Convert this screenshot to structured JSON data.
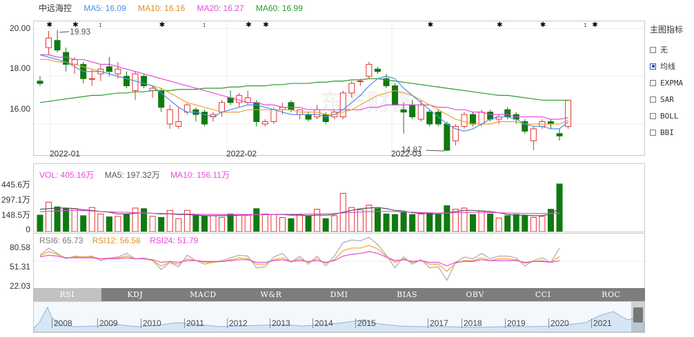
{
  "legend": {
    "name": "中远海控",
    "ma5": "MA5: 16.09",
    "ma10": "MA10: 16.16",
    "ma20": "MA20: 16.27",
    "ma60": "MA60: 16.99"
  },
  "colors": {
    "ma5": "#4a90e2",
    "ma10": "#f0a030",
    "ma20": "#e64ad8",
    "ma60": "#2a9a2a",
    "up": "#e53030",
    "down": "#0f7a0f"
  },
  "main_axis": [
    "20.00",
    "18.00",
    "16.00"
  ],
  "x_labels": [
    "2022-01",
    "2022-02",
    "2022-03"
  ],
  "annotations": {
    "high": "19.93",
    "low": "14.87"
  },
  "watermark": "东方财富",
  "side": {
    "title": "主图指标",
    "items": [
      {
        "label": "无",
        "checked": false
      },
      {
        "label": "均线",
        "checked": true
      },
      {
        "label": "EXPMA",
        "checked": false
      },
      {
        "label": "SAR",
        "checked": false
      },
      {
        "label": "BOLL",
        "checked": false
      },
      {
        "label": "BBI",
        "checked": false
      }
    ]
  },
  "vol": {
    "legend": {
      "vol": "VOL: 405.16万",
      "ma5": "MA5: 197.32万",
      "ma10": "MA10: 156.11万"
    },
    "axis": [
      "445.6万",
      "297.1万",
      "148.5万",
      "0"
    ]
  },
  "rsi": {
    "legend": {
      "rsi6": "RSI6: 65.73",
      "rsi12": "RSI12: 56.58",
      "rsi24": "RSI24: 51.79"
    },
    "axis": [
      "80.58",
      "51.31",
      "22.03"
    ]
  },
  "tabs": [
    {
      "label": "RSI",
      "active": true
    },
    {
      "label": "KDJ",
      "active": false
    },
    {
      "label": "MACD",
      "active": false
    },
    {
      "label": "W&R",
      "active": false
    },
    {
      "label": "DMI",
      "active": false
    },
    {
      "label": "BIAS",
      "active": false
    },
    {
      "label": "OBV",
      "active": false
    },
    {
      "label": "CCI",
      "active": false
    },
    {
      "label": "ROC",
      "active": false
    }
  ],
  "years": [
    "2008",
    "2009",
    "2010",
    "2011",
    "2012",
    "2013",
    "2014",
    "2015",
    "2017",
    "2018",
    "2019",
    "2020",
    "2021"
  ],
  "chart_data": {
    "type": "candlestick",
    "ylim": [
      14.7,
      20.3
    ],
    "candles": [
      {
        "o": 17.8,
        "h": 18.0,
        "l": 17.6,
        "c": 17.7
      },
      {
        "o": 19.2,
        "h": 19.9,
        "l": 18.9,
        "c": 19.6
      },
      {
        "o": 19.5,
        "h": 19.93,
        "l": 19.0,
        "c": 19.1
      },
      {
        "o": 19.0,
        "h": 19.2,
        "l": 18.2,
        "c": 18.5
      },
      {
        "o": 18.5,
        "h": 18.8,
        "l": 18.1,
        "c": 18.7
      },
      {
        "o": 18.5,
        "h": 18.6,
        "l": 17.7,
        "c": 17.9
      },
      {
        "o": 17.9,
        "h": 18.3,
        "l": 17.6,
        "c": 17.9
      },
      {
        "o": 18.1,
        "h": 18.5,
        "l": 17.8,
        "c": 18.3
      },
      {
        "o": 18.4,
        "h": 18.8,
        "l": 18.0,
        "c": 18.2
      },
      {
        "o": 18.1,
        "h": 18.6,
        "l": 17.9,
        "c": 18.3
      },
      {
        "o": 18.0,
        "h": 18.2,
        "l": 17.5,
        "c": 17.6
      },
      {
        "o": 17.4,
        "h": 18.2,
        "l": 17.0,
        "c": 18.1
      },
      {
        "o": 18.0,
        "h": 18.1,
        "l": 17.5,
        "c": 17.6
      },
      {
        "o": 17.4,
        "h": 17.6,
        "l": 17.1,
        "c": 17.5
      },
      {
        "o": 17.4,
        "h": 17.5,
        "l": 16.5,
        "c": 16.7
      },
      {
        "o": 16.0,
        "h": 16.8,
        "l": 15.8,
        "c": 16.6
      },
      {
        "o": 15.9,
        "h": 16.7,
        "l": 15.8,
        "c": 16.1
      },
      {
        "o": 16.5,
        "h": 16.9,
        "l": 16.4,
        "c": 16.8
      },
      {
        "o": 16.6,
        "h": 16.7,
        "l": 16.1,
        "c": 16.4
      },
      {
        "o": 16.5,
        "h": 16.6,
        "l": 15.9,
        "c": 16.0
      },
      {
        "o": 16.3,
        "h": 16.5,
        "l": 16.1,
        "c": 16.4
      },
      {
        "o": 16.5,
        "h": 17.0,
        "l": 16.3,
        "c": 16.9
      },
      {
        "o": 17.1,
        "h": 17.4,
        "l": 16.8,
        "c": 16.9
      },
      {
        "o": 16.9,
        "h": 17.3,
        "l": 16.7,
        "c": 17.2
      },
      {
        "o": 16.9,
        "h": 17.4,
        "l": 16.8,
        "c": 17.1
      },
      {
        "o": 16.9,
        "h": 17.0,
        "l": 15.9,
        "c": 16.1
      },
      {
        "o": 16.0,
        "h": 16.2,
        "l": 15.9,
        "c": 16.1
      },
      {
        "o": 16.1,
        "h": 16.7,
        "l": 16.0,
        "c": 16.6
      },
      {
        "o": 16.6,
        "h": 16.9,
        "l": 16.4,
        "c": 16.7
      },
      {
        "o": 16.9,
        "h": 17.0,
        "l": 16.5,
        "c": 16.6
      },
      {
        "o": 16.4,
        "h": 16.6,
        "l": 16.2,
        "c": 16.6
      },
      {
        "o": 16.4,
        "h": 16.5,
        "l": 16.1,
        "c": 16.2
      },
      {
        "o": 16.3,
        "h": 16.8,
        "l": 16.2,
        "c": 16.6
      },
      {
        "o": 16.4,
        "h": 16.5,
        "l": 16.0,
        "c": 16.1
      },
      {
        "o": 16.3,
        "h": 16.6,
        "l": 16.2,
        "c": 16.5
      },
      {
        "o": 16.3,
        "h": 17.4,
        "l": 16.2,
        "c": 17.3
      },
      {
        "o": 17.3,
        "h": 17.8,
        "l": 17.1,
        "c": 17.7
      },
      {
        "o": 17.8,
        "h": 17.9,
        "l": 17.6,
        "c": 17.8
      },
      {
        "o": 18.0,
        "h": 18.6,
        "l": 17.9,
        "c": 18.5
      },
      {
        "o": 18.3,
        "h": 18.4,
        "l": 18.1,
        "c": 18.2
      },
      {
        "o": 17.9,
        "h": 18.1,
        "l": 17.5,
        "c": 17.6
      },
      {
        "o": 17.6,
        "h": 17.7,
        "l": 16.8,
        "c": 16.8
      },
      {
        "o": 16.6,
        "h": 16.9,
        "l": 15.6,
        "c": 16.5
      },
      {
        "o": 16.8,
        "h": 17.0,
        "l": 16.2,
        "c": 16.3
      },
      {
        "o": 16.2,
        "h": 17.0,
        "l": 16.1,
        "c": 16.8
      },
      {
        "o": 16.5,
        "h": 16.6,
        "l": 15.9,
        "c": 16.0
      },
      {
        "o": 16.5,
        "h": 16.6,
        "l": 15.9,
        "c": 16.0
      },
      {
        "o": 16.0,
        "h": 16.1,
        "l": 14.87,
        "c": 14.9
      },
      {
        "o": 15.3,
        "h": 16.0,
        "l": 15.1,
        "c": 15.9
      },
      {
        "o": 15.9,
        "h": 16.5,
        "l": 15.8,
        "c": 16.4
      },
      {
        "o": 16.4,
        "h": 16.5,
        "l": 15.9,
        "c": 16.0
      },
      {
        "o": 16.0,
        "h": 16.6,
        "l": 15.9,
        "c": 16.5
      },
      {
        "o": 16.5,
        "h": 16.6,
        "l": 16.1,
        "c": 16.2
      },
      {
        "o": 16.2,
        "h": 16.4,
        "l": 16.0,
        "c": 16.3
      },
      {
        "o": 16.6,
        "h": 16.7,
        "l": 16.2,
        "c": 16.3
      },
      {
        "o": 16.4,
        "h": 16.5,
        "l": 16.0,
        "c": 16.2
      },
      {
        "o": 16.1,
        "h": 16.2,
        "l": 15.6,
        "c": 15.7
      },
      {
        "o": 15.3,
        "h": 15.9,
        "l": 14.9,
        "c": 15.8
      },
      {
        "o": 15.9,
        "h": 16.2,
        "l": 15.8,
        "c": 16.1
      },
      {
        "o": 16.1,
        "h": 16.2,
        "l": 15.8,
        "c": 16.0
      },
      {
        "o": 15.6,
        "h": 15.8,
        "l": 15.3,
        "c": 15.5
      },
      {
        "o": 15.9,
        "h": 17.0,
        "l": 15.8,
        "c": 17.0
      }
    ],
    "ma5": [
      18.9,
      18.8,
      18.7,
      18.6,
      18.4,
      18.2,
      18.2,
      18.2,
      18.1,
      18.0,
      17.9,
      17.8,
      17.7,
      17.6,
      17.3,
      17.0,
      16.7,
      16.5,
      16.5,
      16.4,
      16.3,
      16.5,
      16.6,
      16.7,
      16.8,
      16.8,
      16.7,
      16.6,
      16.5,
      16.4,
      16.4,
      16.4,
      16.4,
      16.3,
      16.4,
      16.6,
      16.9,
      17.2,
      17.6,
      17.9,
      18.0,
      17.9,
      17.5,
      17.2,
      16.9,
      16.6,
      16.3,
      16.0,
      15.8,
      15.7,
      15.8,
      16.0,
      16.2,
      16.3,
      16.3,
      16.2,
      16.0,
      15.9,
      15.9,
      15.8,
      15.8,
      16.09
    ],
    "ma10": [
      18.7,
      18.7,
      18.6,
      18.6,
      18.5,
      18.4,
      18.3,
      18.2,
      18.1,
      18.0,
      17.9,
      17.8,
      17.7,
      17.6,
      17.5,
      17.3,
      17.1,
      16.9,
      16.8,
      16.7,
      16.6,
      16.5,
      16.5,
      16.5,
      16.6,
      16.6,
      16.6,
      16.6,
      16.6,
      16.6,
      16.5,
      16.5,
      16.5,
      16.4,
      16.4,
      16.5,
      16.6,
      16.8,
      17.0,
      17.2,
      17.3,
      17.4,
      17.3,
      17.2,
      17.0,
      16.8,
      16.6,
      16.4,
      16.2,
      16.1,
      16.0,
      16.0,
      16.0,
      16.1,
      16.1,
      16.1,
      16.0,
      16.0,
      16.0,
      16.0,
      16.0,
      16.16
    ],
    "ma20": [
      18.9,
      18.9,
      18.8,
      18.8,
      18.7,
      18.7,
      18.6,
      18.5,
      18.5,
      18.4,
      18.3,
      18.2,
      18.1,
      18.0,
      17.9,
      17.8,
      17.7,
      17.6,
      17.5,
      17.4,
      17.3,
      17.2,
      17.1,
      17.0,
      16.9,
      16.9,
      16.8,
      16.8,
      16.7,
      16.7,
      16.7,
      16.6,
      16.6,
      16.6,
      16.6,
      16.6,
      16.6,
      16.6,
      16.7,
      16.7,
      16.8,
      16.8,
      16.8,
      16.8,
      16.8,
      16.8,
      16.7,
      16.7,
      16.6,
      16.6,
      16.5,
      16.5,
      16.4,
      16.4,
      16.4,
      16.3,
      16.3,
      16.3,
      16.3,
      16.2,
      16.2,
      16.27
    ],
    "ma60": [
      16.9,
      16.95,
      17.0,
      17.05,
      17.1,
      17.15,
      17.2,
      17.2,
      17.25,
      17.3,
      17.3,
      17.35,
      17.35,
      17.4,
      17.4,
      17.4,
      17.45,
      17.45,
      17.45,
      17.5,
      17.5,
      17.5,
      17.55,
      17.55,
      17.6,
      17.6,
      17.6,
      17.65,
      17.65,
      17.7,
      17.7,
      17.7,
      17.75,
      17.75,
      17.8,
      17.8,
      17.85,
      17.85,
      17.9,
      17.9,
      17.85,
      17.8,
      17.75,
      17.7,
      17.65,
      17.6,
      17.55,
      17.5,
      17.45,
      17.4,
      17.35,
      17.3,
      17.25,
      17.2,
      17.2,
      17.15,
      17.1,
      17.05,
      17.0,
      17.0,
      17.0,
      16.99
    ],
    "volume": [
      140,
      250,
      210,
      195,
      195,
      135,
      205,
      150,
      125,
      130,
      145,
      200,
      195,
      130,
      120,
      180,
      110,
      180,
      135,
      130,
      135,
      120,
      150,
      140,
      145,
      195,
      150,
      145,
      120,
      110,
      145,
      130,
      190,
      110,
      135,
      325,
      205,
      185,
      225,
      195,
      150,
      145,
      165,
      145,
      150,
      155,
      145,
      220,
      190,
      200,
      145,
      175,
      150,
      115,
      135,
      145,
      135,
      120,
      130,
      190,
      405
    ],
    "vol_ma5": [
      190,
      195,
      200,
      200,
      195,
      185,
      180,
      170,
      165,
      150,
      150,
      155,
      160,
      155,
      150,
      150,
      145,
      145,
      140,
      135,
      135,
      135,
      135,
      140,
      140,
      145,
      145,
      145,
      145,
      140,
      140,
      135,
      140,
      140,
      145,
      165,
      180,
      195,
      200,
      205,
      195,
      180,
      175,
      160,
      155,
      150,
      150,
      160,
      170,
      180,
      180,
      175,
      170,
      160,
      145,
      140,
      140,
      135,
      135,
      150,
      197.32
    ],
    "vol_ma10": [
      170,
      172,
      175,
      178,
      180,
      178,
      175,
      170,
      168,
      165,
      163,
      160,
      158,
      155,
      155,
      152,
      150,
      150,
      148,
      147,
      146,
      145,
      145,
      145,
      145,
      145,
      146,
      146,
      147,
      147,
      148,
      148,
      150,
      152,
      155,
      158,
      162,
      166,
      170,
      172,
      172,
      170,
      168,
      165,
      162,
      160,
      158,
      158,
      160,
      162,
      163,
      163,
      162,
      160,
      158,
      156,
      155,
      154,
      154,
      155,
      156.11
    ],
    "rsi6": [
      58,
      66,
      60,
      54,
      57,
      56,
      57,
      52,
      55,
      56,
      60,
      54,
      55,
      52,
      42,
      50,
      45,
      58,
      52,
      48,
      50,
      52,
      55,
      58,
      57,
      44,
      45,
      56,
      60,
      50,
      57,
      48,
      57,
      46,
      57,
      72,
      75,
      74,
      78,
      70,
      58,
      44,
      56,
      48,
      53,
      44,
      45,
      30,
      50,
      56,
      54,
      60,
      54,
      57,
      57,
      55,
      46,
      52,
      55,
      50,
      65.73
    ],
    "rsi12": [
      57,
      62,
      59,
      55,
      56,
      56,
      56,
      54,
      55,
      55,
      57,
      54,
      54,
      52,
      46,
      50,
      48,
      54,
      52,
      50,
      50,
      51,
      53,
      55,
      54,
      48,
      48,
      53,
      55,
      51,
      54,
      50,
      54,
      49,
      53,
      63,
      66,
      66,
      69,
      65,
      57,
      50,
      54,
      50,
      52,
      48,
      48,
      40,
      49,
      52,
      52,
      55,
      52,
      54,
      54,
      53,
      49,
      51,
      52,
      50,
      56.58
    ],
    "rsi24": [
      56,
      58,
      57,
      55,
      55,
      55,
      55,
      54,
      54,
      54,
      55,
      54,
      54,
      53,
      50,
      51,
      50,
      52,
      52,
      51,
      51,
      51,
      52,
      53,
      53,
      50,
      50,
      52,
      53,
      51,
      52,
      51,
      52,
      50,
      52,
      57,
      59,
      60,
      62,
      60,
      56,
      52,
      53,
      51,
      52,
      50,
      50,
      46,
      50,
      51,
      51,
      53,
      52,
      52,
      52,
      52,
      50,
      51,
      51,
      50,
      51.79
    ]
  }
}
